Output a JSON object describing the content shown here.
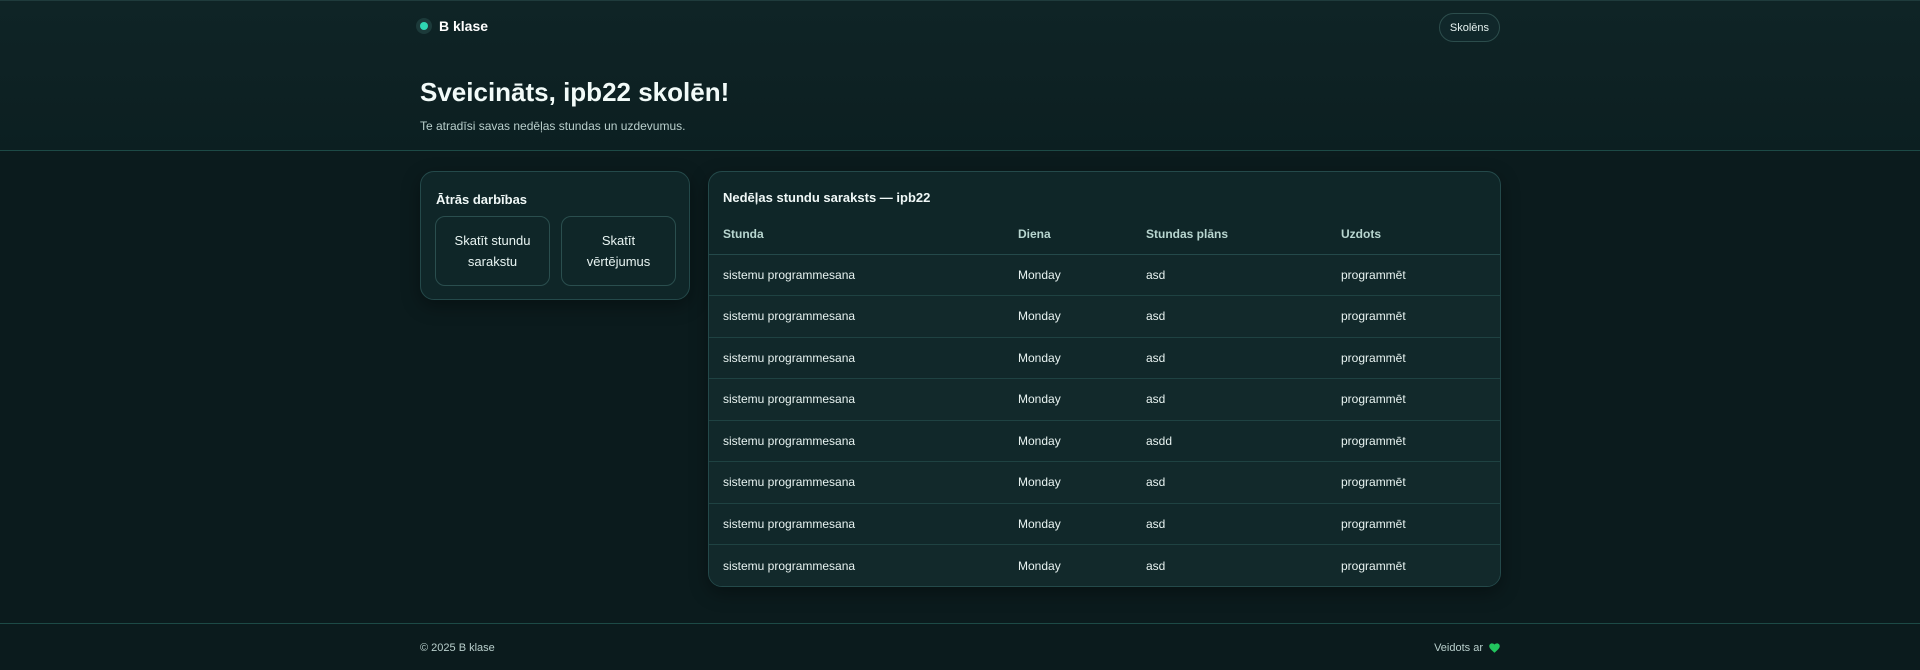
{
  "header": {
    "brand": "B klase",
    "role": "Skolēns",
    "greeting": "Sveicināts, ipb22 skolēn!",
    "subtitle": "Te atradīsi savas nedēļas stundas un uzdevumus."
  },
  "quick_actions": {
    "title": "Ātrās darbības",
    "buttons": [
      "Skatīt stundu sarakstu",
      "Skatīt vērtējumus"
    ]
  },
  "schedule": {
    "title": "Nedēļas stundu saraksts — ipb22",
    "columns": [
      "Stunda",
      "Diena",
      "Stundas plāns",
      "Uzdots"
    ],
    "rows": [
      [
        "sistemu programmesana",
        "Monday",
        "asd",
        "programmēt"
      ],
      [
        "sistemu programmesana",
        "Monday",
        "asd",
        "programmēt"
      ],
      [
        "sistemu programmesana",
        "Monday",
        "asd",
        "programmēt"
      ],
      [
        "sistemu programmesana",
        "Monday",
        "asd",
        "programmēt"
      ],
      [
        "sistemu programmesana",
        "Monday",
        "asdd",
        "programmēt"
      ],
      [
        "sistemu programmesana",
        "Monday",
        "asd",
        "programmēt"
      ],
      [
        "sistemu programmesana",
        "Monday",
        "asd",
        "programmēt"
      ],
      [
        "sistemu programmesana",
        "Monday",
        "asd",
        "programmēt"
      ]
    ]
  },
  "footer": {
    "copyright": "© 2025 B klase",
    "made_with": "Veidots ar",
    "heart_icon": "heart-icon",
    "heart_color": "#22c55e"
  },
  "colors": {
    "accent": "#2fd6b3",
    "background": "#0b1b1d",
    "card": "#0f2628"
  }
}
